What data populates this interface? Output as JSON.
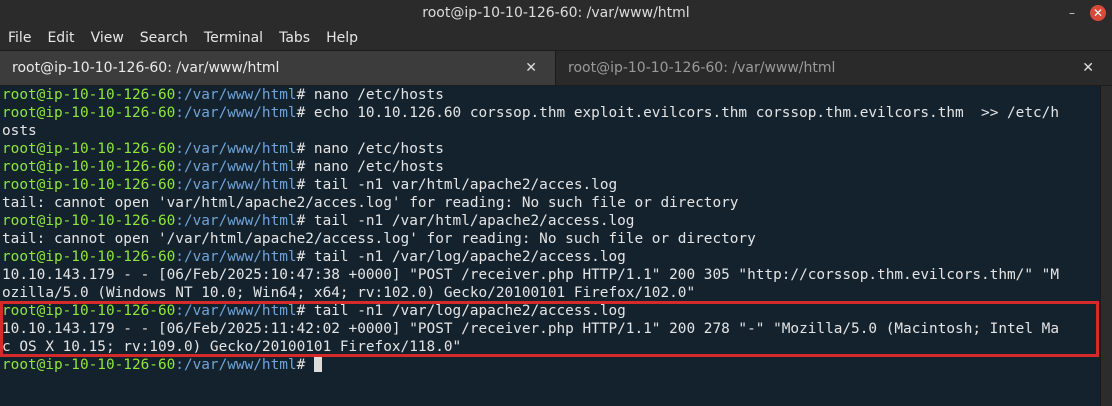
{
  "window": {
    "title": "root@ip-10-10-126-60: /var/www/html"
  },
  "menu": [
    "File",
    "Edit",
    "View",
    "Search",
    "Terminal",
    "Tabs",
    "Help"
  ],
  "tabs": [
    {
      "label": "root@ip-10-10-126-60: /var/www/html",
      "close": "✕"
    },
    {
      "label": "root@ip-10-10-126-60: /var/www/html",
      "close": "✕"
    }
  ],
  "prompt": {
    "user": "root@ip-10-10-126-60",
    "path": ":/var/www/html",
    "sym": "# "
  },
  "lines": [
    {
      "type": "cmd",
      "text": "nano /etc/hosts"
    },
    {
      "type": "cmd",
      "text": "echo 10.10.126.60 corssop.thm exploit.evilcors.thm corssop.thm.evilcors.thm  >> /etc/h"
    },
    {
      "type": "out",
      "text": "osts"
    },
    {
      "type": "cmd",
      "text": "nano /etc/hosts"
    },
    {
      "type": "cmd",
      "text": "nano /etc/hosts"
    },
    {
      "type": "cmd",
      "text": "tail -n1 var/html/apache2/acces.log"
    },
    {
      "type": "out",
      "text": "tail: cannot open 'var/html/apache2/acces.log' for reading: No such file or directory"
    },
    {
      "type": "cmd",
      "text": "tail -n1 /var/html/apache2/access.log"
    },
    {
      "type": "out",
      "text": "tail: cannot open '/var/html/apache2/access.log' for reading: No such file or directory"
    },
    {
      "type": "cmd",
      "text": "tail -n1 /var/log/apache2/access.log"
    },
    {
      "type": "out",
      "text": "10.10.143.179 - - [06/Feb/2025:10:47:38 +0000] \"POST /receiver.php HTTP/1.1\" 200 305 \"http://corssop.thm.evilcors.thm/\" \"M"
    },
    {
      "type": "out",
      "text": "ozilla/5.0 (Windows NT 10.0; Win64; x64; rv:102.0) Gecko/20100101 Firefox/102.0\""
    },
    {
      "type": "cmd",
      "text": "tail -n1 /var/log/apache2/access.log"
    },
    {
      "type": "out",
      "text": "10.10.143.179 - - [06/Feb/2025:11:42:02 +0000] \"POST /receiver.php HTTP/1.1\" 200 278 \"-\" \"Mozilla/5.0 (Macintosh; Intel Ma"
    },
    {
      "type": "out",
      "text": "c OS X 10.15; rv:109.0) Gecko/20100101 Firefox/118.0\""
    },
    {
      "type": "cmd",
      "text": ""
    }
  ],
  "colors": {
    "prompt_user": "#8ee635",
    "prompt_path": "#6fa3d8",
    "highlight": "#d62a2a"
  }
}
